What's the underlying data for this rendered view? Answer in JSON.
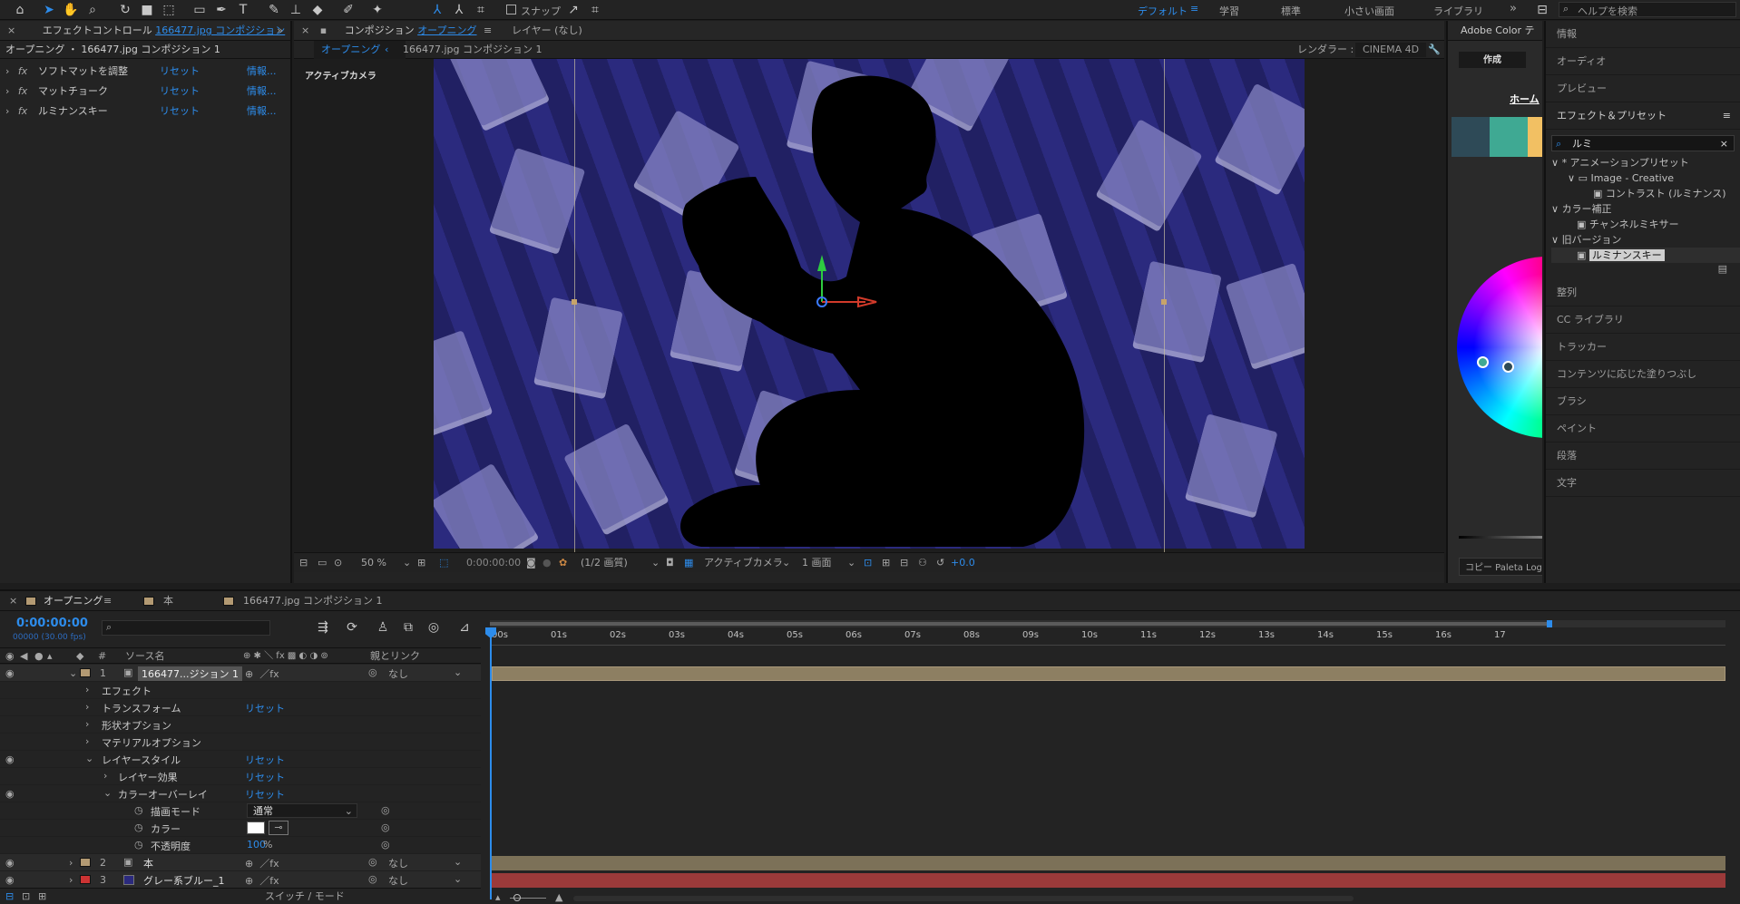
{
  "toolbar": {
    "snap_label": "スナップ",
    "workspaces": [
      "デフォルト",
      "学習",
      "標準",
      "小さい画面",
      "ライブラリ"
    ],
    "workspace_menu_icon": "≡",
    "more_icon": "»",
    "help_placeholder": "ヘルプを検索"
  },
  "effect_controls": {
    "tab_prefix": "エフェクトコントロール",
    "tab_layer": "166477.jpg コンポジション",
    "breadcrumb": "オープニング ・ 166477.jpg コンポジション 1",
    "effects": [
      {
        "name": "ソフトマットを調整",
        "reset": "リセット",
        "info": "情報..."
      },
      {
        "name": "マットチョーク",
        "reset": "リセット",
        "info": "情報..."
      },
      {
        "name": "ルミナンスキー",
        "reset": "リセット",
        "info": "情報..."
      }
    ]
  },
  "composition": {
    "tab_prefix": "コンポジション",
    "tab_name": "オープニング",
    "tab_menu_icon": "≡",
    "layer_tab": "レイヤー (なし)",
    "sub_tab": "オープニング",
    "sub_breadcrumb": "166477.jpg コンポジション 1",
    "renderer_label": "レンダラー :",
    "renderer_value": "CINEMA 4D",
    "active_camera": "アクティブカメラ",
    "footer": {
      "zoom": "50 %",
      "timecode": "0:00:00:00",
      "resolution": "(1/2 画質)",
      "camera": "アクティブカメラ",
      "views": "1 画面",
      "exposure": "+0.0"
    }
  },
  "adobe_color": {
    "title": "Adobe Color テ",
    "create_tab": "作成",
    "home_link": "ホーム",
    "swatches": [
      "#2e4a57",
      "#3fa993",
      "#f2c063"
    ],
    "copy_label": "コピー Paleta Logo"
  },
  "right_panel": {
    "info": "情報",
    "audio": "オーディオ",
    "preview": "プレビュー",
    "effects_presets": "エフェクト＆プリセット",
    "effects_menu_icon": "≡",
    "search_value": "ルミ",
    "tree": [
      {
        "label": "* アニメーションプリセット",
        "indent": 0,
        "arrow": "∨"
      },
      {
        "label": "Image - Creative",
        "indent": 1,
        "arrow": "∨"
      },
      {
        "label": "コントラスト (ルミナンス)",
        "indent": 2,
        "arrow": ""
      },
      {
        "label": "カラー補正",
        "indent": 0,
        "arrow": "∨"
      },
      {
        "label": "チャンネルミキサー",
        "indent": 1,
        "arrow": ""
      },
      {
        "label": "旧バージョン",
        "indent": 0,
        "arrow": "∨"
      },
      {
        "label": "ルミナンスキー",
        "indent": 1,
        "arrow": "",
        "selected": true
      }
    ],
    "items": [
      "整列",
      "CC ライブラリ",
      "トラッカー",
      "コンテンツに応じた塗りつぶし",
      "ブラシ",
      "ペイント",
      "段落",
      "文字"
    ]
  },
  "timeline": {
    "tabs": [
      {
        "label": "オープニング",
        "active": true,
        "color": "#b39a73"
      },
      {
        "label": "本",
        "active": false,
        "color": "#b39a73"
      },
      {
        "label": "166477.jpg コンポジション 1",
        "active": false,
        "color": "#b39a73"
      }
    ],
    "tab_menu_icon": "≡",
    "timecode": "0:00:00:00",
    "fps": "00000 (30.00 fps)",
    "col_source": "ソース名",
    "col_parent": "親とリンク",
    "switches_label": "スイッチ / モード",
    "ticks": [
      "00s",
      "01s",
      "02s",
      "03s",
      "04s",
      "05s",
      "06s",
      "07s",
      "08s",
      "09s",
      "10s",
      "11s",
      "12s",
      "13s",
      "14s",
      "15s",
      "16s",
      "17"
    ],
    "layers": [
      {
        "num": "1",
        "name": "166477...ジション 1",
        "parent": "なし",
        "label_color": "#b39a73",
        "bar_color": "#8d7f62"
      },
      {
        "num": "2",
        "name": "本",
        "parent": "なし",
        "label_color": "#b39a73",
        "bar_color": "#7c7158"
      },
      {
        "num": "3",
        "name": "グレー系ブルー_1",
        "parent": "なし",
        "label_color": "#cc3333",
        "bar_color": "#9b3a3a"
      }
    ],
    "props": [
      {
        "label": "エフェクト",
        "indent": 1,
        "reset": ""
      },
      {
        "label": "トランスフォーム",
        "indent": 1,
        "reset": "リセット"
      },
      {
        "label": "形状オプション",
        "indent": 1,
        "reset": ""
      },
      {
        "label": "マテリアルオプション",
        "indent": 1,
        "reset": ""
      },
      {
        "label": "レイヤースタイル",
        "indent": 1,
        "reset": "リセット"
      },
      {
        "label": "レイヤー効果",
        "indent": 2,
        "reset": "リセット"
      },
      {
        "label": "カラーオーバーレイ",
        "indent": 2,
        "reset": "リセット"
      },
      {
        "label": "描画モード",
        "indent": 3,
        "reset": ""
      },
      {
        "label": "カラー",
        "indent": 3,
        "reset": ""
      },
      {
        "label": "不透明度",
        "indent": 3,
        "reset": ""
      }
    ],
    "blend_mode": "通常",
    "opacity": "100",
    "opacity_unit": "%",
    "playhead_progress": 0.0,
    "work_area_end_progress": 0.855
  }
}
